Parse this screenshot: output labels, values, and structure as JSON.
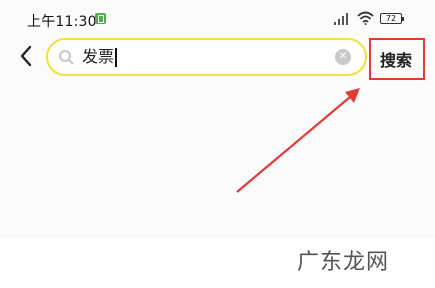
{
  "status_bar": {
    "time": "上午11:30",
    "battery": "72"
  },
  "search": {
    "query": "发票",
    "submit_label": "搜索"
  },
  "watermark": "广东龙网",
  "colors": {
    "search_border": "#f2e13a",
    "annotation": "#e53935"
  },
  "icons": [
    "back-arrow-icon",
    "search-icon",
    "clear-icon",
    "signal-icon",
    "wifi-icon",
    "battery-icon"
  ]
}
